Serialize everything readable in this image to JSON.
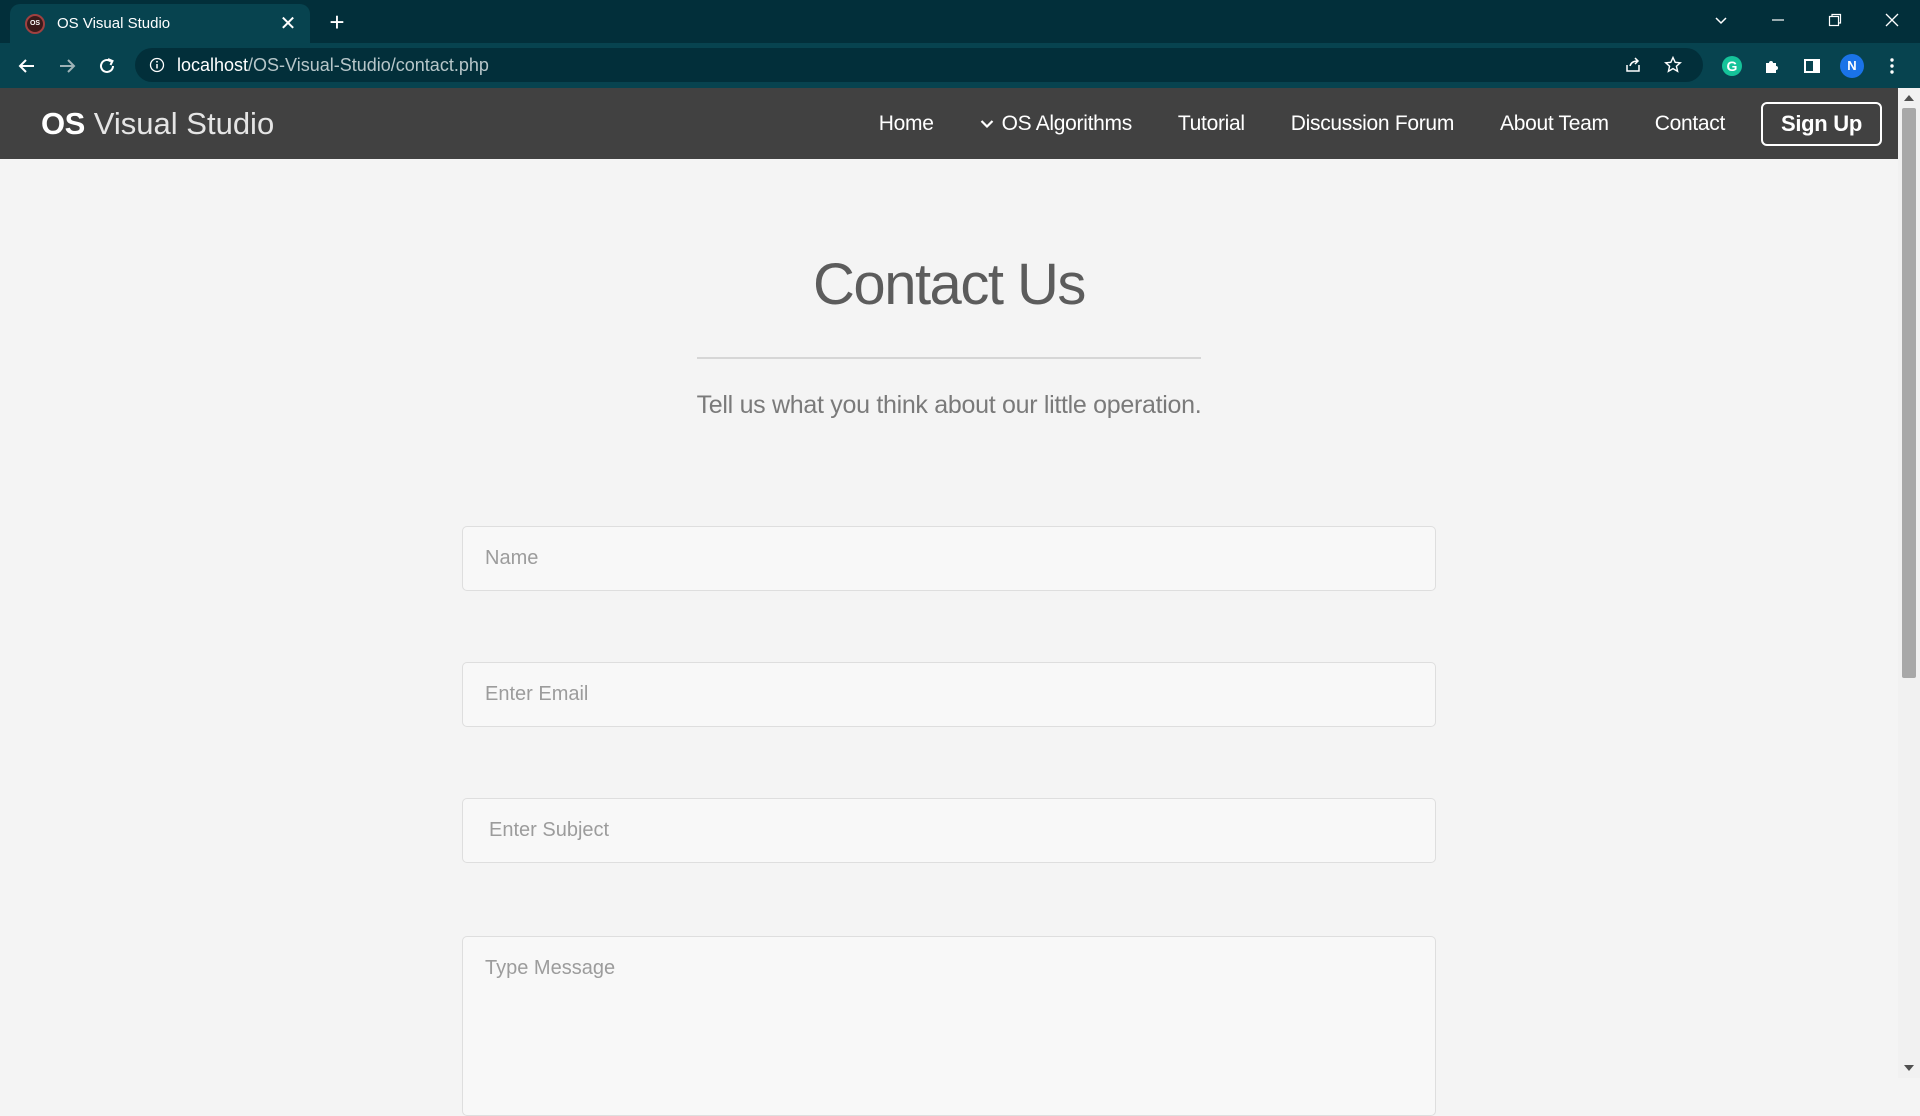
{
  "browser": {
    "tab_title": "OS Visual Studio",
    "favicon_text": "OS",
    "tab_close": "✕",
    "new_tab": "+",
    "url_host": "localhost",
    "url_path": "/OS-Visual-Studio/contact.php",
    "profile_initial": "N",
    "grammarly_letter": "G"
  },
  "navbar": {
    "brand_strong": "OS",
    "brand_light": "Visual Studio",
    "links": [
      {
        "label": "Home"
      },
      {
        "label": "OS Algorithms"
      },
      {
        "label": "Tutorial"
      },
      {
        "label": "Discussion Forum"
      },
      {
        "label": "About Team"
      },
      {
        "label": "Contact"
      }
    ],
    "signup_label": "Sign Up"
  },
  "contact": {
    "heading": "Contact Us",
    "tagline": "Tell us what you think about our little operation.",
    "name_placeholder": "Name",
    "email_placeholder": "Enter Email",
    "subject_placeholder": "Enter Subject",
    "message_placeholder": "Type Message"
  },
  "colors": {
    "chrome_dark": "#022f3a",
    "chrome_tab": "#07434f",
    "navbar_bg": "#414141",
    "page_bg": "#f4f4f4"
  }
}
